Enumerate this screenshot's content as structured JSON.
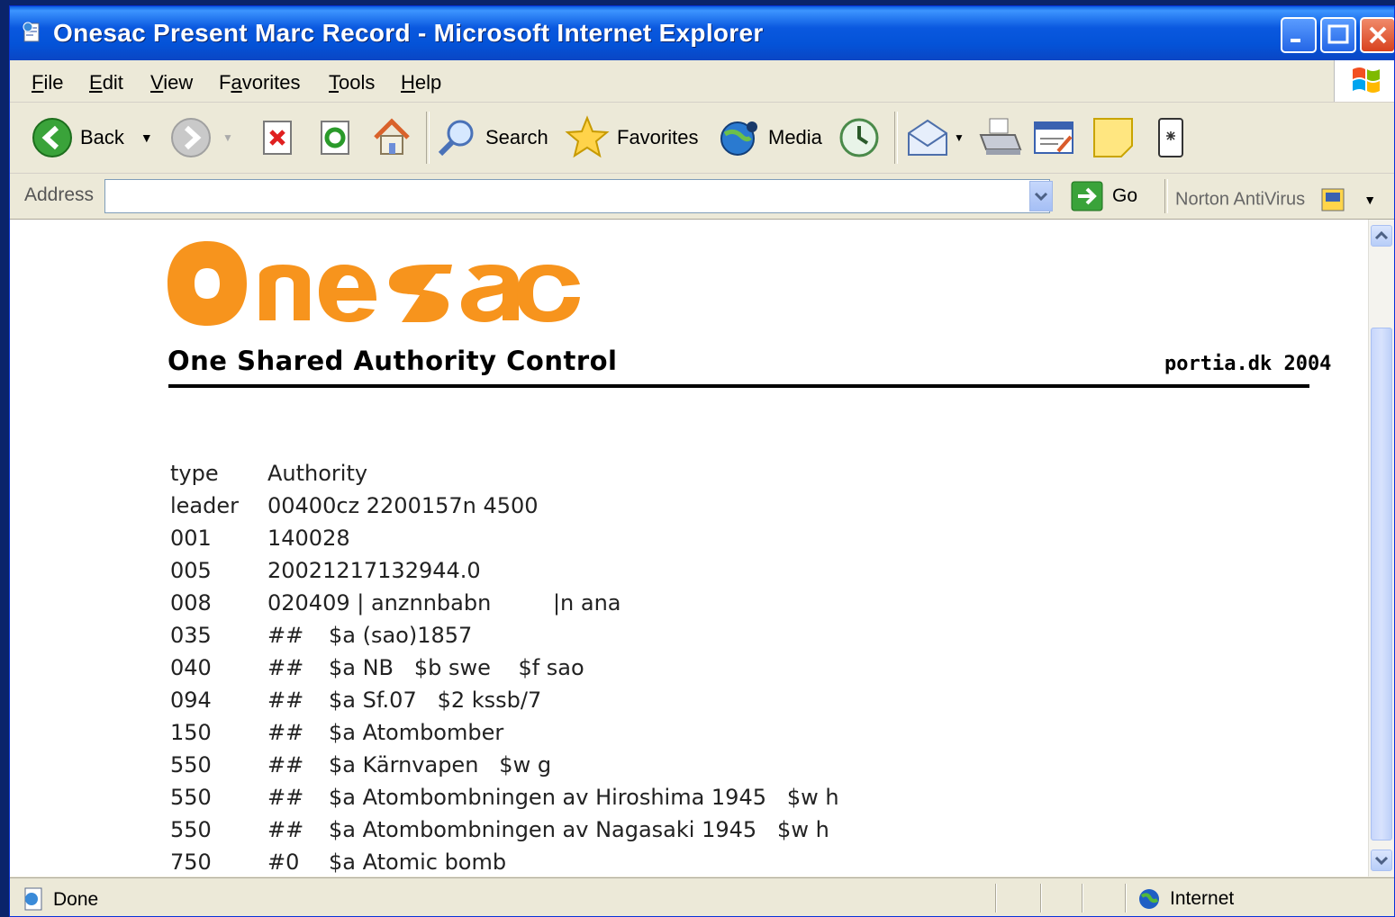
{
  "window": {
    "title": "Onesac Present Marc Record - Microsoft Internet Explorer"
  },
  "menu": {
    "items": [
      {
        "label": "File",
        "key": "F",
        "rest": "ile"
      },
      {
        "label": "Edit",
        "key": "E",
        "rest": "dit"
      },
      {
        "label": "View",
        "key": "V",
        "rest": "iew"
      },
      {
        "label": "Favorites",
        "pre": "F",
        "key": "a",
        "rest": "vorites"
      },
      {
        "label": "Tools",
        "key": "T",
        "rest": "ools"
      },
      {
        "label": "Help",
        "key": "H",
        "rest": "elp"
      }
    ]
  },
  "toolbar": {
    "back_label": "Back",
    "search_label": "Search",
    "favorites_label": "Favorites",
    "media_label": "Media"
  },
  "address": {
    "label": "Address",
    "value": "",
    "go_label": "Go",
    "norton_label": "Norton AntiVirus"
  },
  "page": {
    "logo_text": "Onesac",
    "tagline": "One Shared Authority Control",
    "credit": "portia.dk 2004",
    "record": [
      {
        "tag": "type",
        "ind": "Authority",
        "sub": ""
      },
      {
        "tag": "leader",
        "ind": "00400cz 2200157n 4500",
        "sub": ""
      },
      {
        "tag": "001",
        "ind": "140028",
        "sub": ""
      },
      {
        "tag": "005",
        "ind": "20021217132944.0",
        "sub": ""
      },
      {
        "tag": "008",
        "ind": "020409 | anznnbabn         |n ana",
        "sub": ""
      },
      {
        "tag": "035",
        "ind": "##",
        "sub": "$a (sao)1857"
      },
      {
        "tag": "040",
        "ind": "##",
        "sub": "$a NB   $b swe    $f sao"
      },
      {
        "tag": "094",
        "ind": "##",
        "sub": "$a Sf.07   $2 kssb/7"
      },
      {
        "tag": "150",
        "ind": "##",
        "sub": "$a Atombomber"
      },
      {
        "tag": "550",
        "ind": "##",
        "sub": "$a Kärnvapen   $w g"
      },
      {
        "tag": "550",
        "ind": "##",
        "sub": "$a Atombombningen av Hiroshima 1945   $w h"
      },
      {
        "tag": "550",
        "ind": "##",
        "sub": "$a Atombombningen av Nagasaki 1945   $w h"
      },
      {
        "tag": "750",
        "ind": "#0",
        "sub": "$a Atomic bomb"
      }
    ]
  },
  "status": {
    "text": "Done",
    "zone": "Internet"
  },
  "colors": {
    "logo": "#f7941d",
    "titlebar": "#0a58df"
  }
}
